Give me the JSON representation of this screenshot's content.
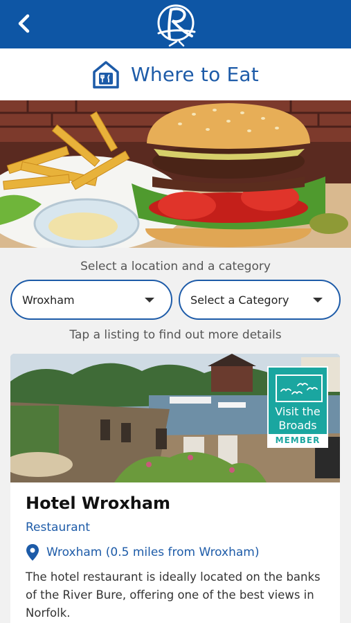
{
  "header": {
    "back_icon": "chevron-left-icon",
    "logo_icon": "brand-r-logo",
    "bar_color": "#0e56a5"
  },
  "title_bar": {
    "icon": "restaurant-house-icon",
    "title": "Where to Eat"
  },
  "hero": {
    "image": "burger-and-fries-photo"
  },
  "filters": {
    "prompt": "Select a location and a category",
    "location": {
      "value": "Wroxham"
    },
    "category": {
      "value": "Select a Category"
    },
    "hint": "Tap a listing to find out more details"
  },
  "listing": {
    "photo": "riverside-terrace-photo",
    "badge": {
      "line1": "Visit the",
      "line2": "Broads",
      "member": "MEMBER",
      "color": "#1aa6a0"
    },
    "name": "Hotel Wroxham",
    "category": "Restaurant",
    "location": "Wroxham (0.5 miles from Wroxham)",
    "description": "The hotel restaurant is ideally located on the banks of the River Bure, offering one of the best views in Norfolk."
  },
  "colors": {
    "accent": "#1d5ba8"
  }
}
